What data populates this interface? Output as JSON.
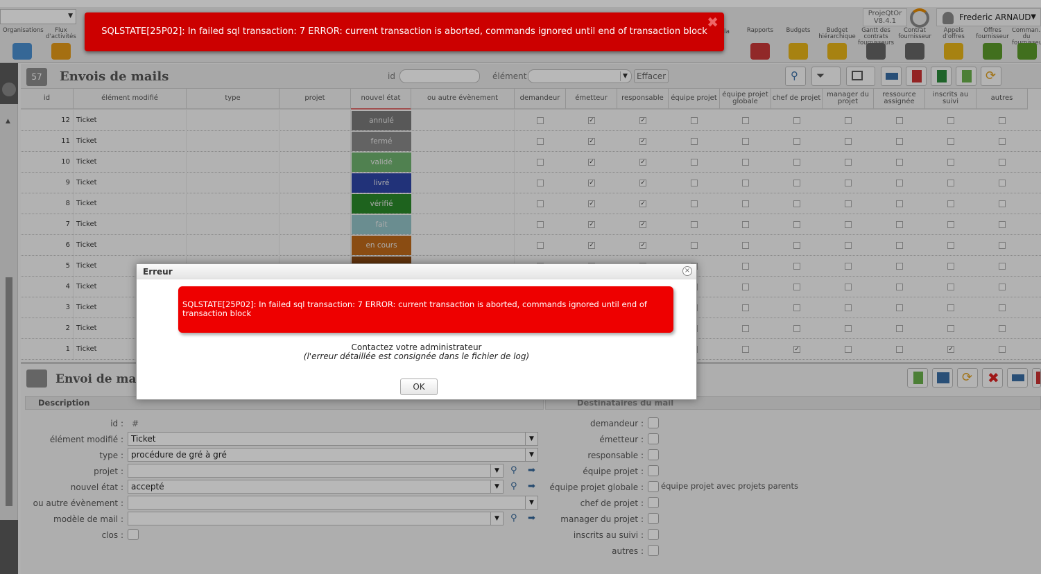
{
  "menubar": {
    "items": [
      {
        "label": "Organisations",
        "color": "#4a8fd0"
      },
      {
        "label": "Flux d'activités",
        "color": "#e59a18"
      },
      {
        "label": "Rapports",
        "color": "#c93838"
      },
      {
        "label": "Budgets",
        "color": "#e8b418"
      },
      {
        "label": "Budget hiérarchique",
        "color": "#e8b418"
      },
      {
        "label": "Gantt des contrats fournisseurs",
        "color": "#666666"
      },
      {
        "label": "Contrat fournisseur",
        "color": "#666666"
      },
      {
        "label": "Appels d'offres",
        "color": "#e8b418"
      },
      {
        "label": "Offres fournisseur",
        "color": "#5a9a2a"
      },
      {
        "label": "Comman... du fournisseur",
        "color": "#5a9a2a"
      }
    ],
    "partial_label": "la",
    "version_line1": "ProjeQtOr",
    "version_line2": "V8.4.1",
    "user_name": "Frederic ARNAUD"
  },
  "list": {
    "count_icon": "57",
    "title": "Envois de mails",
    "filter_id_label": "id",
    "filter_element_label": "élément",
    "clear_label": "Effacer",
    "columns": [
      "id",
      "élément modifié",
      "type",
      "projet",
      "nouvel état",
      "ou autre évènement",
      "demandeur",
      "émetteur",
      "responsable",
      "équipe projet",
      "équipe projet globale",
      "chef de projet",
      "manager du projet",
      "ressource assignée",
      "inscrits au suivi",
      "autres"
    ],
    "rows": [
      {
        "id": "12",
        "element": "Ticket",
        "status": "annulé",
        "status_color": "#7a7a7a",
        "checks": [
          0,
          1,
          1,
          0,
          0,
          0,
          0,
          0,
          0,
          0
        ]
      },
      {
        "id": "11",
        "element": "Ticket",
        "status": "fermé",
        "status_color": "#8a8a8a",
        "checks": [
          0,
          1,
          1,
          0,
          0,
          0,
          0,
          0,
          0,
          0
        ]
      },
      {
        "id": "10",
        "element": "Ticket",
        "status": "validé",
        "status_color": "#6fb36f",
        "checks": [
          0,
          1,
          1,
          0,
          0,
          0,
          0,
          0,
          0,
          0
        ]
      },
      {
        "id": "9",
        "element": "Ticket",
        "status": "livré",
        "status_color": "#2e46a8",
        "checks": [
          0,
          1,
          1,
          0,
          0,
          0,
          0,
          0,
          0,
          0
        ]
      },
      {
        "id": "8",
        "element": "Ticket",
        "status": "vérifié",
        "status_color": "#2a8a2a",
        "checks": [
          0,
          1,
          1,
          0,
          0,
          0,
          0,
          0,
          0,
          0
        ]
      },
      {
        "id": "7",
        "element": "Ticket",
        "status": "fait",
        "status_color": "#94c4c8",
        "checks": [
          0,
          1,
          1,
          0,
          0,
          0,
          0,
          0,
          0,
          0
        ]
      },
      {
        "id": "6",
        "element": "Ticket",
        "status": "en cours",
        "status_color": "#c06a1a",
        "checks": [
          0,
          1,
          1,
          0,
          0,
          0,
          0,
          0,
          0,
          0
        ]
      },
      {
        "id": "5",
        "element": "Ticket",
        "status": "",
        "status_color": "#8a4a14",
        "checks": [
          0,
          0,
          0,
          0,
          0,
          0,
          0,
          0,
          0,
          0
        ]
      },
      {
        "id": "4",
        "element": "Ticket",
        "status": "",
        "status_color": "",
        "checks": [
          0,
          0,
          0,
          0,
          0,
          0,
          0,
          0,
          0,
          0
        ]
      },
      {
        "id": "3",
        "element": "Ticket",
        "status": "",
        "status_color": "",
        "checks": [
          0,
          0,
          0,
          0,
          0,
          0,
          0,
          0,
          0,
          0
        ]
      },
      {
        "id": "2",
        "element": "Ticket",
        "status": "",
        "status_color": "",
        "checks": [
          0,
          0,
          0,
          0,
          0,
          0,
          0,
          0,
          0,
          0
        ]
      },
      {
        "id": "1",
        "element": "Ticket",
        "status": "",
        "status_color": "",
        "checks": [
          0,
          0,
          0,
          0,
          0,
          1,
          0,
          0,
          1,
          0
        ]
      }
    ]
  },
  "detail": {
    "title": "Envoi de mai",
    "section_description": "Description",
    "section_recipients": "Destinataires du mail",
    "fields": {
      "id_label": "id :",
      "id_value": "#",
      "element_label": "élément modifié :",
      "element_value": "Ticket",
      "type_label": "type :",
      "type_value": "procédure de gré à gré",
      "project_label": "projet :",
      "project_value": "",
      "status_label": "nouvel état :",
      "status_value": "accepté",
      "event_label": "ou autre évènement :",
      "event_value": "",
      "template_label": "modèle de mail :",
      "template_value": "",
      "closed_label": "clos :"
    },
    "recipients": {
      "requestor": "demandeur :",
      "issuer": "émetteur :",
      "responsible": "responsable :",
      "team": "équipe projet :",
      "global_team": "équipe projet globale :",
      "global_team_note": "équipe projet avec projets parents",
      "leader": "chef de projet :",
      "manager": "manager du projet :",
      "followers": "inscrits au suivi :",
      "others": "autres :"
    }
  },
  "banner": {
    "message": "SQLSTATE[25P02]: In failed sql transaction: 7 ERROR: current transaction is aborted, commands ignored until end of transaction block",
    "close_glyph": "✖"
  },
  "dialog": {
    "title": "Erreur",
    "message": "SQLSTATE[25P02]: In failed sql transaction: 7 ERROR: current transaction is aborted, commands ignored until end of transaction block",
    "contact": "Contactez votre administrateur",
    "contact_note": "(l'erreur détaillée est consignée dans le fichier de log)",
    "ok_label": "OK"
  }
}
